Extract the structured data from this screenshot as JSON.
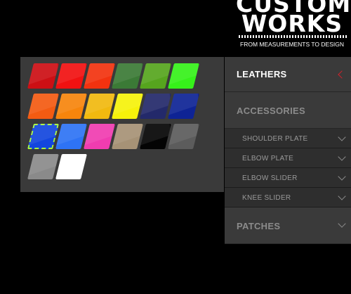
{
  "logo": {
    "line1": "CUSTOM",
    "line2": "WORKS",
    "tagline": "FROM MEASUREMENTS TO DESIGN"
  },
  "swatches": [
    {
      "name": "swatch-dark-red",
      "color": "#cc0f14"
    },
    {
      "name": "swatch-red",
      "color": "#f11111"
    },
    {
      "name": "swatch-red-orange",
      "color": "#f2320f"
    },
    {
      "name": "swatch-dark-green",
      "color": "#3b7a36"
    },
    {
      "name": "swatch-green",
      "color": "#56a51e"
    },
    {
      "name": "swatch-bright-green",
      "color": "#36f11a"
    },
    {
      "name": "swatch-orange-red",
      "color": "#f35b12"
    },
    {
      "name": "swatch-orange",
      "color": "#f7850c"
    },
    {
      "name": "swatch-gold",
      "color": "#f1b90f"
    },
    {
      "name": "swatch-yellow",
      "color": "#f6f20a"
    },
    {
      "name": "swatch-navy",
      "color": "#23296a"
    },
    {
      "name": "swatch-royal-navy",
      "color": "#0e2395"
    },
    {
      "name": "swatch-blue",
      "color": "#1346de"
    },
    {
      "name": "swatch-light-blue",
      "color": "#2e73f5"
    },
    {
      "name": "swatch-pink",
      "color": "#f03cb0"
    },
    {
      "name": "swatch-tan",
      "color": "#a69276"
    },
    {
      "name": "swatch-black",
      "color": "#040404"
    },
    {
      "name": "swatch-dark-grey",
      "color": "#5c5c5c"
    },
    {
      "name": "swatch-grey",
      "color": "#8a8a8a"
    },
    {
      "name": "swatch-white",
      "color": "#ffffff"
    }
  ],
  "selected_swatch": 12,
  "menu": {
    "leathers": "LEATHERS",
    "accessories": "ACCESSORIES",
    "shoulder_plate": "SHOULDER PLATE",
    "elbow_plate": "ELBOW PLATE",
    "elbow_slider": "ELBOW SLIDER",
    "knee_slider": "KNEE SLIDER",
    "patches": "PATCHES"
  }
}
